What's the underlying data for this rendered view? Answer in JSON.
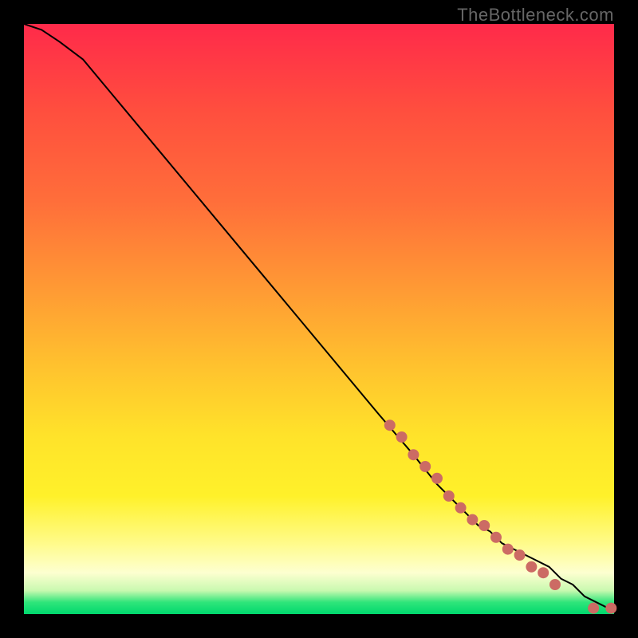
{
  "watermark": "TheBottleneck.com",
  "chart_data": {
    "type": "line",
    "title": "",
    "xlabel": "",
    "ylabel": "",
    "xlim": [
      0,
      100
    ],
    "ylim": [
      0,
      100
    ],
    "line": {
      "x": [
        0,
        3,
        6,
        10,
        20,
        30,
        40,
        50,
        60,
        66,
        70,
        73,
        75,
        77,
        79,
        81,
        83,
        85,
        87,
        89,
        91,
        93,
        95,
        97,
        99,
        100
      ],
      "y": [
        100,
        99,
        97,
        94,
        82,
        70,
        58,
        46,
        34,
        27,
        22,
        19,
        17,
        15,
        14,
        12,
        11,
        10,
        9,
        8,
        6,
        5,
        3,
        2,
        1,
        1
      ]
    },
    "markers": {
      "color": "#cc6b64",
      "radius": 7,
      "points": [
        {
          "x": 62,
          "y": 32
        },
        {
          "x": 64,
          "y": 30
        },
        {
          "x": 66,
          "y": 27
        },
        {
          "x": 68,
          "y": 25
        },
        {
          "x": 70,
          "y": 23
        },
        {
          "x": 72,
          "y": 20
        },
        {
          "x": 74,
          "y": 18
        },
        {
          "x": 76,
          "y": 16
        },
        {
          "x": 78,
          "y": 15
        },
        {
          "x": 80,
          "y": 13
        },
        {
          "x": 82,
          "y": 11
        },
        {
          "x": 84,
          "y": 10
        },
        {
          "x": 86,
          "y": 8
        },
        {
          "x": 88,
          "y": 7
        },
        {
          "x": 90,
          "y": 5
        },
        {
          "x": 96.5,
          "y": 1
        },
        {
          "x": 99.5,
          "y": 1
        }
      ]
    }
  }
}
